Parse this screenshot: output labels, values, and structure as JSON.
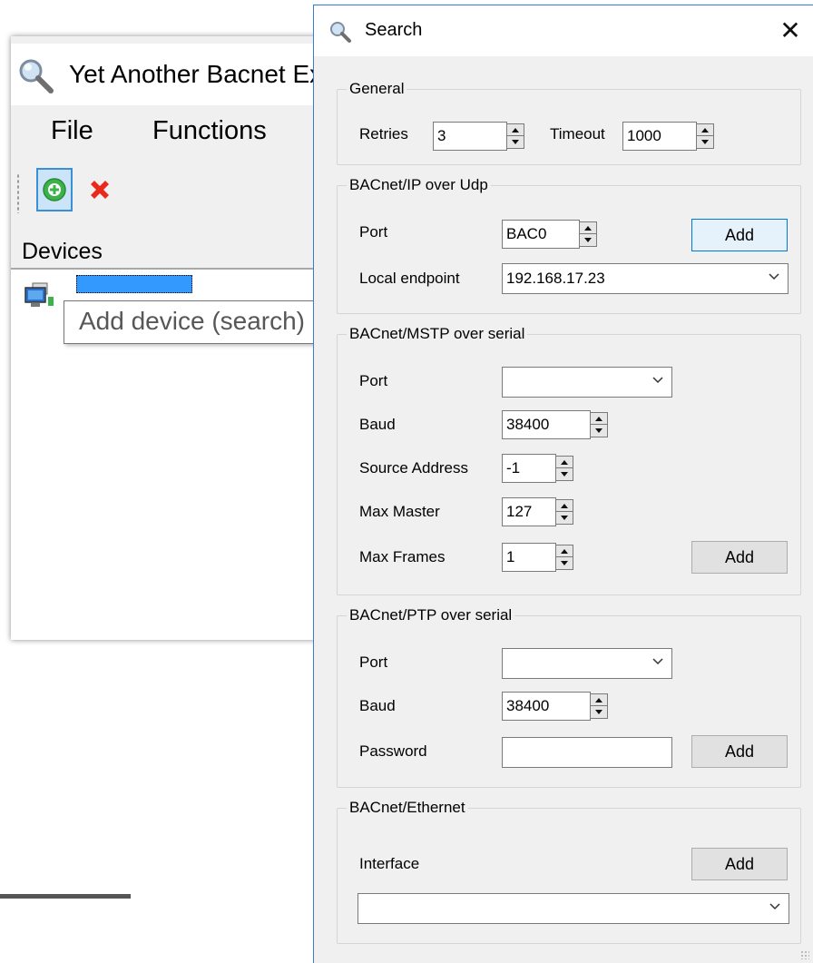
{
  "main_window": {
    "title": "Yet Another Bacnet Explorer",
    "menu": [
      "File",
      "Functions"
    ],
    "devices_label": "Devices",
    "tree_root": "Devices",
    "tooltip": "Add device (search)"
  },
  "dialog": {
    "title": "Search",
    "close_glyph": "✕",
    "general": {
      "legend": "General",
      "retries_label": "Retries",
      "retries_value": "3",
      "timeout_label": "Timeout",
      "timeout_value": "1000"
    },
    "ip": {
      "legend": "BACnet/IP over Udp",
      "port_label": "Port",
      "port_value": "BAC0",
      "add_label": "Add",
      "endpoint_label": "Local endpoint",
      "endpoint_value": "192.168.17.23"
    },
    "mstp": {
      "legend": "BACnet/MSTP over serial",
      "port_label": "Port",
      "port_value": "",
      "baud_label": "Baud",
      "baud_value": "38400",
      "source_label": "Source Address",
      "source_value": "-1",
      "maxmaster_label": "Max Master",
      "maxmaster_value": "127",
      "maxframes_label": "Max Frames",
      "maxframes_value": "1",
      "add_label": "Add"
    },
    "ptp": {
      "legend": "BACnet/PTP over serial",
      "port_label": "Port",
      "port_value": "",
      "baud_label": "Baud",
      "baud_value": "38400",
      "password_label": "Password",
      "password_value": "",
      "add_label": "Add"
    },
    "ethernet": {
      "legend": "BACnet/Ethernet",
      "interface_label": "Interface",
      "interface_value": "",
      "add_label": "Add"
    }
  },
  "colors": {
    "accent": "#3b7bd3",
    "selection": "#3399ff",
    "add_icon": "#3cb34a",
    "delete_icon": "#e8291c"
  },
  "icons": [
    "magnifier-icon",
    "add-circle-icon",
    "delete-x-icon",
    "network-computer-icon",
    "close-icon",
    "chevron-down-icon"
  ]
}
